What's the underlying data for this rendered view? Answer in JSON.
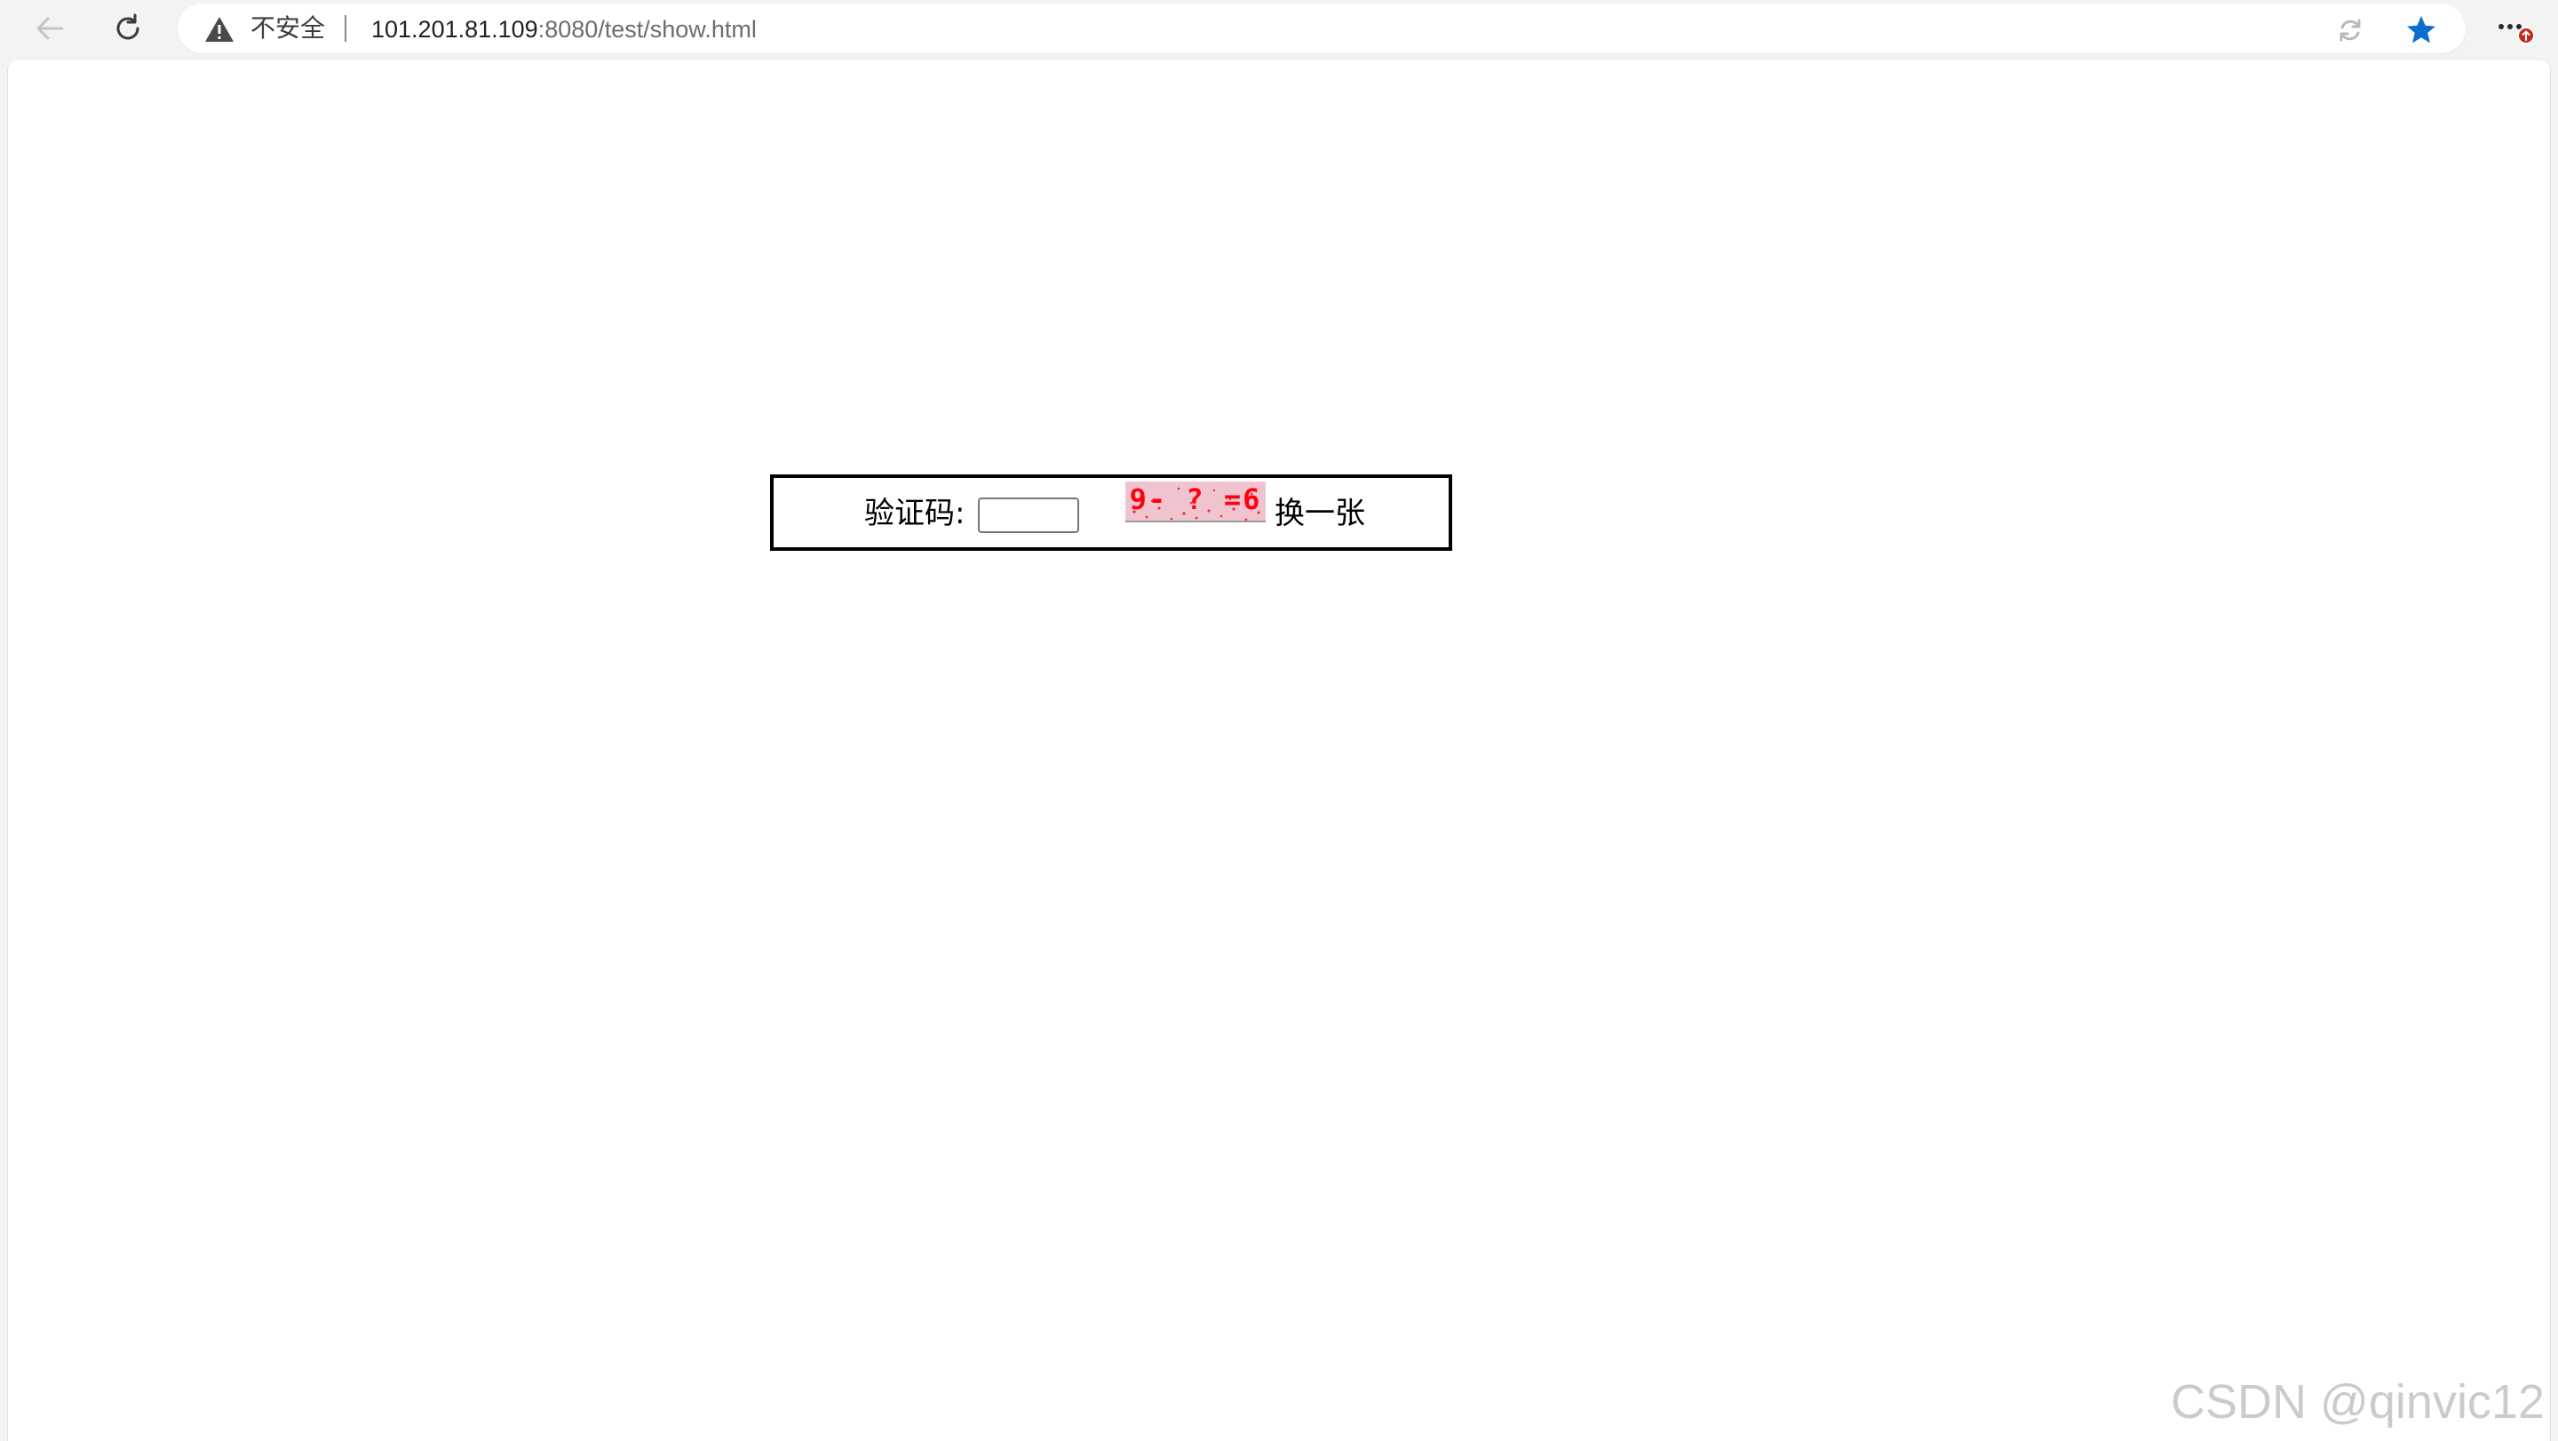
{
  "browser": {
    "security_label": "不安全",
    "url_host": "101.201.81.109",
    "url_rest": ":8080/test/show.html",
    "accent_color": "#0a6ed1",
    "badge_color": "#c42b1c",
    "icons": {
      "back": "back-arrow-icon",
      "refresh": "refresh-icon",
      "warning": "warning-icon",
      "immersive_reader": "edge-refresh-icon",
      "favorite": "star-icon",
      "more": "more-icon"
    }
  },
  "captcha": {
    "label": "验证码:",
    "input_value": "",
    "image_text": "9- ? =6",
    "refresh_label": "换一张",
    "image_bg": "#f0c4cf",
    "image_fg": "#ff0010"
  },
  "watermark": "CSDN @qinvic12"
}
